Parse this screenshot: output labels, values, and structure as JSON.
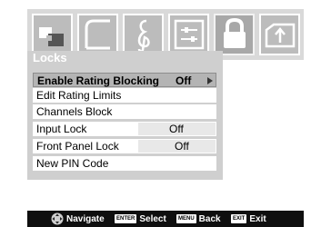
{
  "tabs": [
    {
      "icon": "picture-icon"
    },
    {
      "icon": "screen-icon"
    },
    {
      "icon": "music-note-icon"
    },
    {
      "icon": "setup-icon"
    },
    {
      "icon": "lock-icon",
      "active": true
    },
    {
      "icon": "input-folder-icon"
    }
  ],
  "menu": {
    "title": "Locks",
    "items": [
      {
        "label": "Enable Rating Blocking",
        "value": "Off",
        "selected": true
      },
      {
        "label": "Edit Rating Limits"
      },
      {
        "label": "Channels Block"
      },
      {
        "label": "Input Lock",
        "value": "Off"
      },
      {
        "label": "Front Panel Lock",
        "value": "Off"
      },
      {
        "label": "New PIN Code"
      }
    ]
  },
  "footer": {
    "navigate": "Navigate",
    "enter_key": "ENTER",
    "select": "Select",
    "menu_key": "MENU",
    "back": "Back",
    "exit_key": "EXIT",
    "exit": "Exit"
  },
  "colors": {
    "panel": "#cfcfcf",
    "selected_row": "#b4b4b4",
    "footer": "#0f0f0f"
  }
}
